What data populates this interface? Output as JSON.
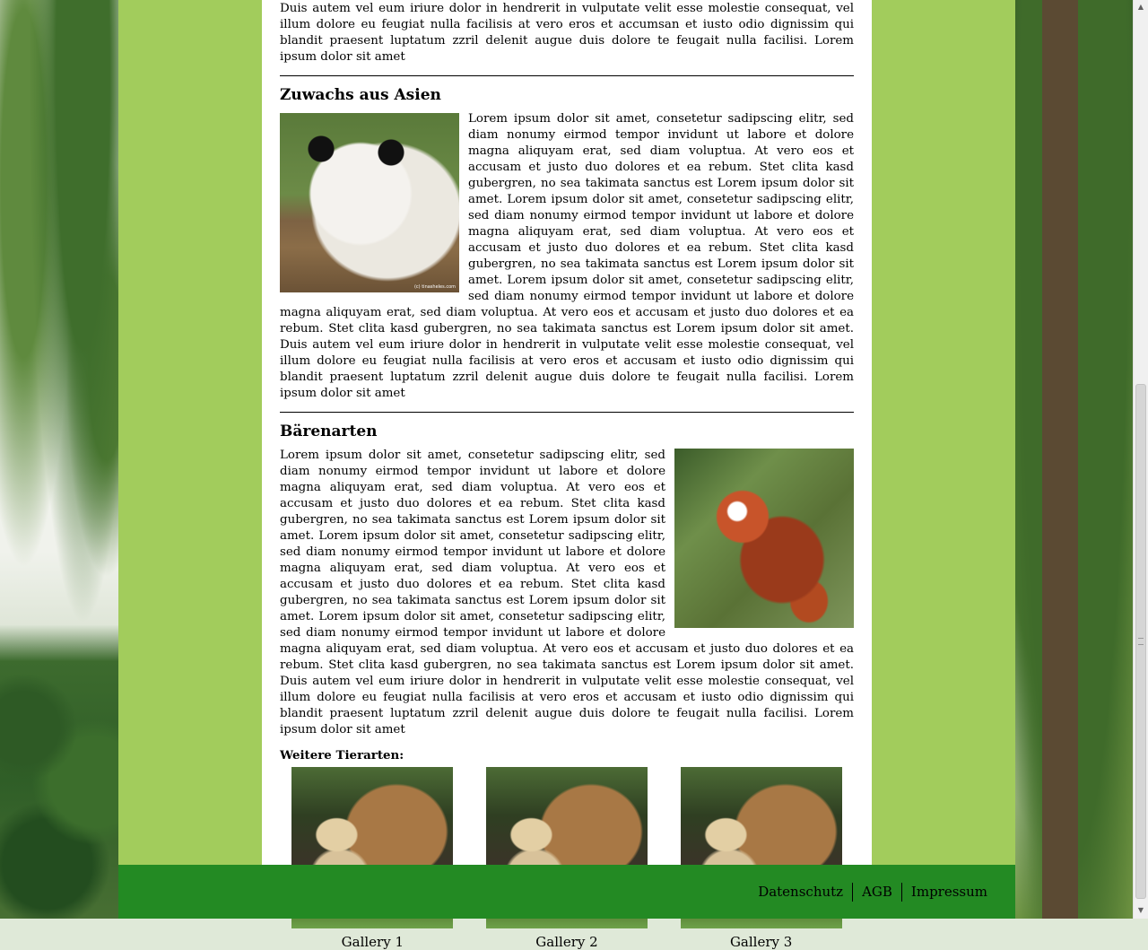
{
  "intro": {
    "paragraph_tail": "Duis autem vel eum iriure dolor in hendrerit in vulputate velit esse molestie consequat, vel illum dolore eu feugiat nulla facilisis at vero eros et accumsan et iusto odio dignissim qui blandit praesent luptatum zzril delenit augue duis dolore te feugait nulla facilisi. Lorem ipsum dolor sit amet"
  },
  "sections": [
    {
      "title": "Zuwachs aus Asien",
      "image_credit": "(c) tinasheles.com",
      "body": "Lorem ipsum dolor sit amet, consetetur sadipscing elitr, sed diam nonumy eirmod tempor invidunt ut labore et dolore magna aliquyam erat, sed diam voluptua. At vero eos et accusam et justo duo dolores et ea rebum. Stet clita kasd gubergren, no sea takimata sanctus est Lorem ipsum dolor sit amet. Lorem ipsum dolor sit amet, consetetur sadipscing elitr, sed diam nonumy eirmod tempor invidunt ut labore et dolore magna aliquyam erat, sed diam voluptua. At vero eos et accusam et justo duo dolores et ea rebum. Stet clita kasd gubergren, no sea takimata sanctus est Lorem ipsum dolor sit amet. Lorem ipsum dolor sit amet, consetetur sadipscing elitr, sed diam nonumy eirmod tempor invidunt ut labore et dolore magna aliquyam erat, sed diam voluptua. At vero eos et accusam et justo duo dolores et ea rebum. Stet clita kasd gubergren, no sea takimata sanctus est Lorem ipsum dolor sit amet. Duis autem vel eum iriure dolor in hendrerit in vulputate velit esse molestie consequat, vel illum dolore eu feugiat nulla facilisis at vero eros et accusam et iusto odio dignissim qui blandit praesent luptatum zzril delenit augue duis dolore te feugait nulla facilisi. Lorem ipsum dolor sit amet"
    },
    {
      "title": "Bärenarten",
      "body": "Lorem ipsum dolor sit amet, consetetur sadipscing elitr, sed diam nonumy eirmod tempor invidunt ut labore et dolore magna aliquyam erat, sed diam voluptua. At vero eos et accusam et justo duo dolores et ea rebum. Stet clita kasd gubergren, no sea takimata sanctus est Lorem ipsum dolor sit amet. Lorem ipsum dolor sit amet, consetetur sadipscing elitr, sed diam nonumy eirmod tempor invidunt ut labore et dolore magna aliquyam erat, sed diam voluptua. At vero eos et accusam et justo duo dolores et ea rebum. Stet clita kasd gubergren, no sea takimata sanctus est Lorem ipsum dolor sit amet. Lorem ipsum dolor sit amet, consetetur sadipscing elitr, sed diam nonumy eirmod tempor invidunt ut labore et dolore magna aliquyam erat, sed diam voluptua. At vero eos et accusam et justo duo dolores et ea rebum. Stet clita kasd gubergren, no sea takimata sanctus est Lorem ipsum dolor sit amet. Duis autem vel eum iriure dolor in hendrerit in vulputate velit esse molestie consequat, vel illum dolore eu feugiat nulla facilisis at vero eros et accusam et iusto odio dignissim qui blandit praesent luptatum zzril delenit augue duis dolore te feugait nulla facilisi. Lorem ipsum dolor sit amet"
    }
  ],
  "gallery": {
    "heading": "Weitere Tierarten:",
    "items": [
      {
        "caption": "Gallery 1"
      },
      {
        "caption": "Gallery 2"
      },
      {
        "caption": "Gallery 3"
      }
    ]
  },
  "footer": {
    "links": [
      "Datenschutz",
      "AGB",
      "Impressum"
    ]
  },
  "colors": {
    "frame_green": "#a2cc5c",
    "footer_green": "#238a23",
    "content_bg": "#ffffff"
  }
}
